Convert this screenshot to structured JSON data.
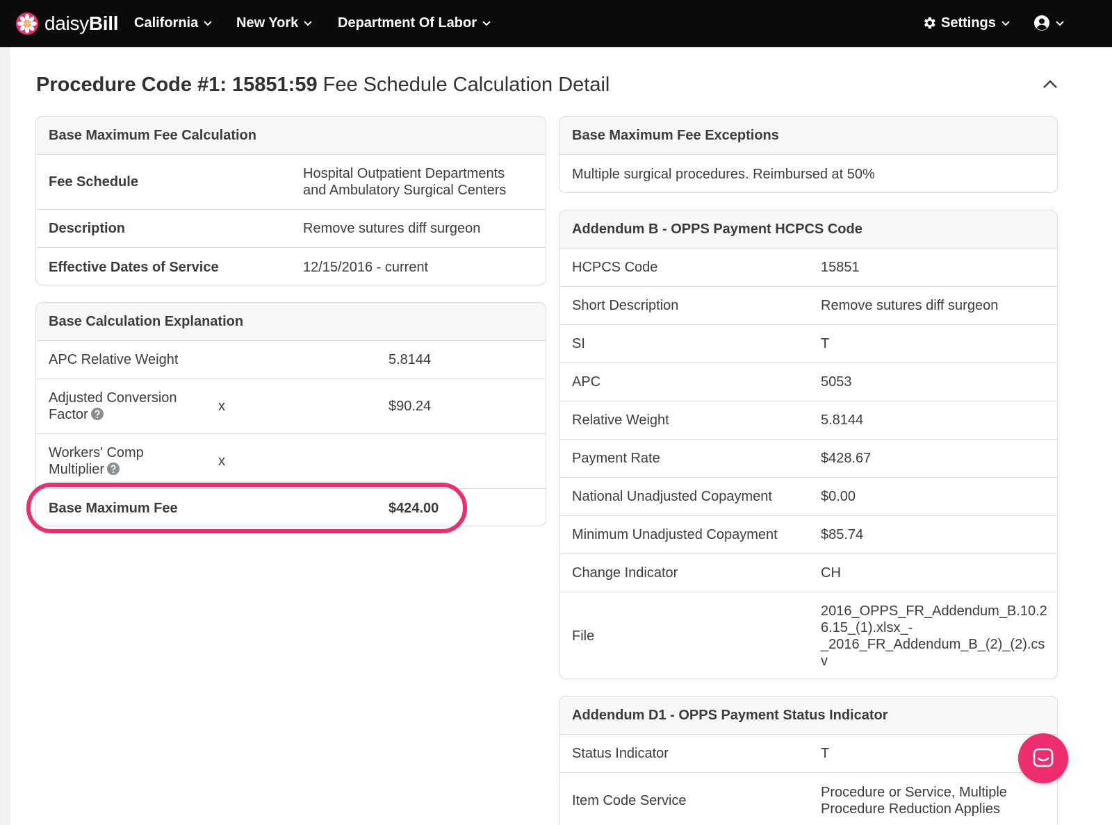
{
  "nav": {
    "brand_prefix": "daisy",
    "brand_suffix": "Bill",
    "items": [
      "California",
      "New York",
      "Department Of Labor"
    ],
    "settings_label": "Settings",
    "icons": [
      "daisy-logo-icon",
      "chevron-down-icon",
      "gear-icon",
      "user-circle-icon"
    ]
  },
  "page": {
    "title_bold": "Procedure Code #1: 15851:59",
    "title_rest": "Fee Schedule Calculation Detail"
  },
  "base_fee_calc": {
    "heading": "Base Maximum Fee Calculation",
    "rows": [
      {
        "label": "Fee Schedule",
        "value_line1": "Hospital Outpatient Departments",
        "value_line2": "and Ambulatory Surgical Centers"
      },
      {
        "label": "Description",
        "value": "Remove sutures diff surgeon"
      },
      {
        "label": "Effective Dates of Service",
        "value": "12/15/2016 - current"
      }
    ]
  },
  "base_calc_explanation": {
    "heading": "Base Calculation Explanation",
    "rows": [
      {
        "label": "APC Relative Weight",
        "op": "",
        "value": "5.8144"
      },
      {
        "label_line1": "Adjusted Conversion",
        "label_line2": "Factor",
        "op": "x",
        "value": "$90.24"
      },
      {
        "label_line1": "Workers' Comp",
        "label_line2": "Multiplier",
        "op": "x",
        "value": ""
      },
      {
        "label": "Base Maximum Fee",
        "op": "",
        "value": "$424.00"
      }
    ]
  },
  "exceptions": {
    "heading": "Base Maximum Fee Exceptions",
    "text": "Multiple surgical procedures. Reimbursed at 50%"
  },
  "addendum_b": {
    "heading": "Addendum B - OPPS Payment HCPCS Code",
    "rows": [
      {
        "label": "HCPCS Code",
        "value": "15851"
      },
      {
        "label": "Short Description",
        "value": "Remove sutures diff surgeon"
      },
      {
        "label": "SI",
        "value": "T"
      },
      {
        "label": "APC",
        "value": "5053"
      },
      {
        "label": "Relative Weight",
        "value": "5.8144"
      },
      {
        "label": "Payment Rate",
        "value": "$428.67"
      },
      {
        "label": "National Unadjusted Copayment",
        "value": "$0.00"
      },
      {
        "label": "Minimum Unadjusted Copayment",
        "value": "$85.74"
      },
      {
        "label": "Change Indicator",
        "value": "CH"
      },
      {
        "label": "File",
        "value_lines": [
          "2016_OPPS_FR_Addendum_B.10.2",
          "6.15_(1).xlsx_-",
          "_2016_FR_Addendum_B_(2)_(2).cs",
          "v"
        ]
      }
    ]
  },
  "addendum_d1": {
    "heading": "Addendum D1 - OPPS Payment Status Indicator",
    "rows": [
      {
        "label": "Status Indicator",
        "value": "T"
      },
      {
        "label": "Item Code Service",
        "value_line1": "Procedure or Service, Multiple",
        "value_line2": "Procedure Reduction Applies"
      }
    ]
  },
  "colors": {
    "nav_bg": "#0b0b0b",
    "accent": "#ee2d6e",
    "card_head_bg": "#f6f7f7",
    "border": "#dadcdd"
  }
}
